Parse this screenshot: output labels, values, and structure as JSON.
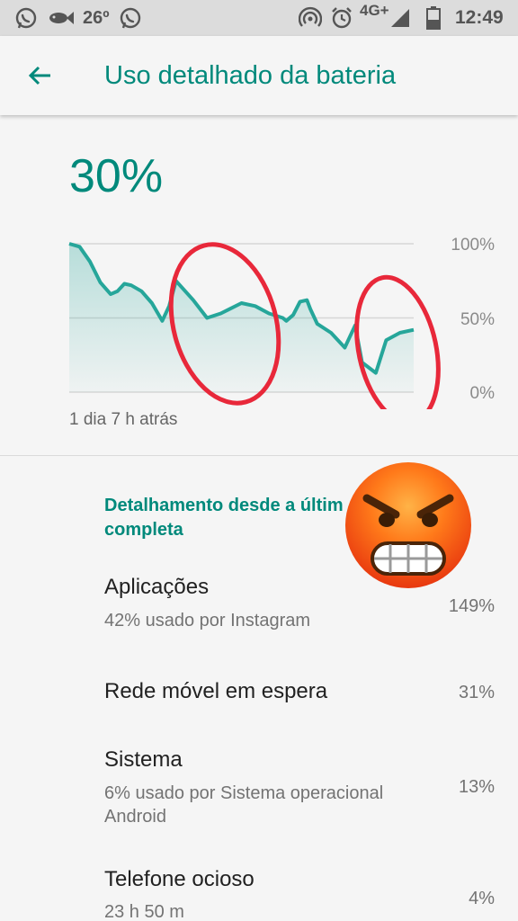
{
  "status_bar": {
    "temperature": "26º",
    "network": "4G+",
    "time": "12:49",
    "icons": [
      "whatsapp-icon",
      "fish-icon",
      "whatsapp-icon",
      "hotspot-icon",
      "alarm-icon",
      "signal-icon",
      "battery-icon"
    ]
  },
  "app_bar": {
    "back_icon": "back-arrow-icon",
    "title": "Uso detalhado da bateria"
  },
  "battery": {
    "percent": "30%",
    "time_ago": "1 dia 7 h atrás"
  },
  "chart_data": {
    "type": "line",
    "y_tick_labels": [
      "100%",
      "50%",
      "0%"
    ],
    "ylim": [
      0,
      100
    ],
    "grid": true,
    "color": "#26a69a",
    "series": [
      {
        "x": [
          0,
          3,
          6,
          9,
          12,
          14,
          16,
          18,
          21,
          24,
          27,
          29,
          31,
          36,
          40,
          44,
          50,
          54,
          58,
          62,
          63,
          65,
          67,
          69,
          70,
          72,
          76,
          80,
          81,
          83,
          85,
          89,
          92,
          96,
          100
        ],
        "values": [
          100,
          98,
          88,
          74,
          66,
          68,
          73,
          72,
          68,
          60,
          48,
          58,
          75,
          62,
          50,
          53,
          60,
          58,
          53,
          50,
          48,
          52,
          61,
          62,
          56,
          46,
          40,
          30,
          35,
          45,
          20,
          13,
          35,
          40,
          42
        ]
      }
    ]
  },
  "section": {
    "title": "Detalhamento desde a últim completa"
  },
  "items": [
    {
      "title": "Aplicações",
      "subtitle": "42% usado por Instagram",
      "value": "149%"
    },
    {
      "title": "Rede móvel em espera",
      "subtitle": "",
      "value": "31%"
    },
    {
      "title": "Sistema",
      "subtitle": "6% usado por Sistema operacional Android",
      "value": "13%"
    },
    {
      "title": "Telefone ocioso",
      "subtitle": "23 h 50 m",
      "value": "4%"
    }
  ],
  "colors": {
    "accent": "#00897b",
    "chart_line": "#26a69a",
    "annotation_red": "#e8283a",
    "status_bar": "#dcdcdc"
  }
}
